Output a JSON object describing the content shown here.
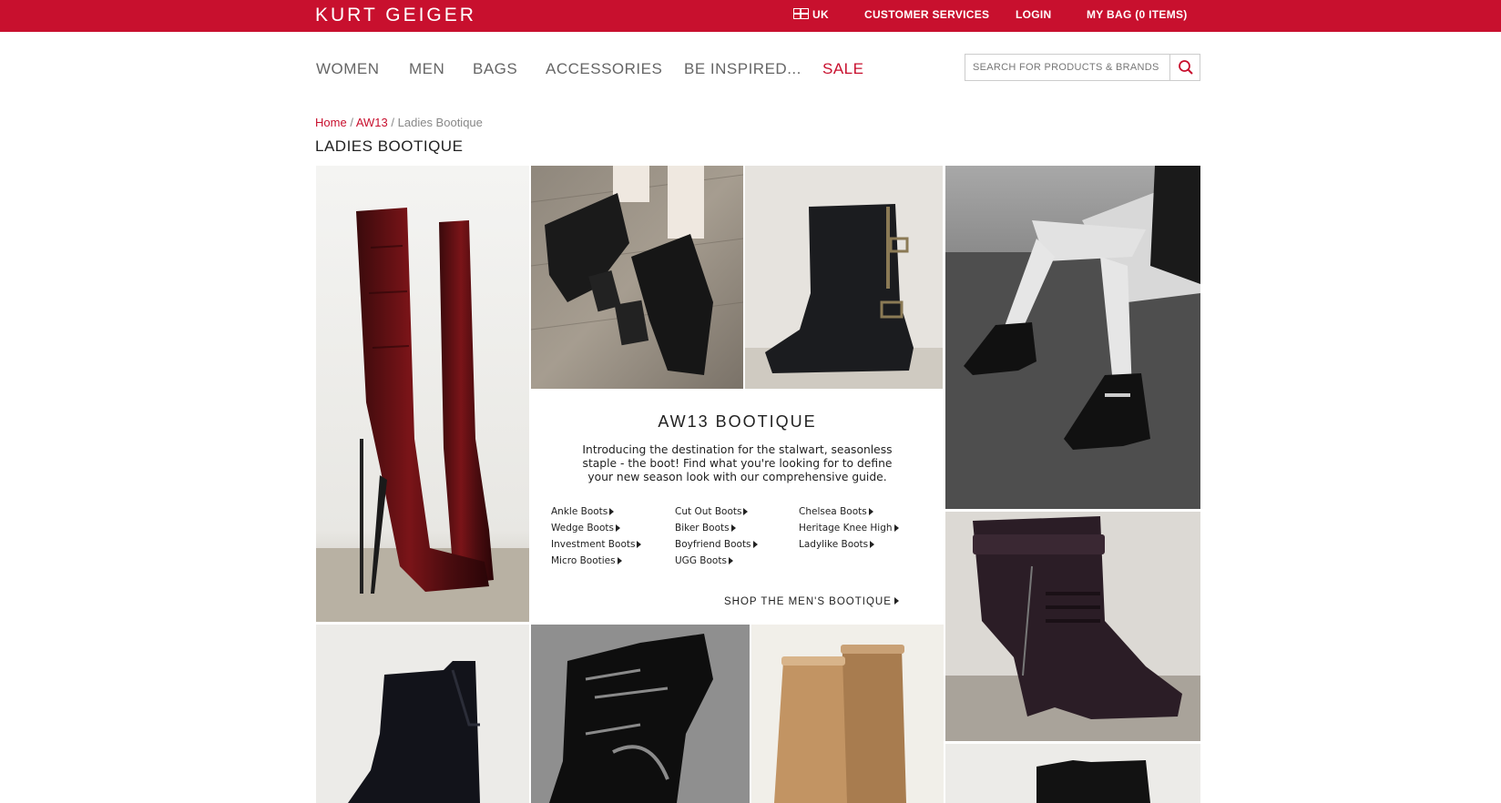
{
  "brand": {
    "logo_text": "KURT GEIGER",
    "accent": "#c8102e"
  },
  "topbar": {
    "country": "UK",
    "customer_services": "CUSTOMER SERVICES",
    "login": "LOGIN",
    "bag": "MY BAG (0 ITEMS)"
  },
  "nav": {
    "women": "WOMEN",
    "men": "MEN",
    "bags": "BAGS",
    "accessories": "ACCESSORIES",
    "inspired": "BE INSPIRED...",
    "sale": "SALE"
  },
  "search": {
    "placeholder": "SEARCH FOR PRODUCTS & BRANDS",
    "icon": "search-icon"
  },
  "breadcrumb": {
    "home": "Home",
    "aw13": "AW13",
    "current": "Ladies Bootique",
    "sep": "/"
  },
  "page_title": "LADIES BOOTIQUE",
  "bootique": {
    "title": "AW13 BOOTIQUE",
    "intro": "Introducing the destination for the stalwart, seasonless staple - the boot! Find what you're looking for to define your new season look with our comprehensive guide.",
    "links": [
      "Ankle Boots",
      "Cut Out Boots",
      "Chelsea Boots",
      "Wedge Boots",
      "Biker Boots",
      "Heritage Knee High",
      "Investment Boots",
      "Boyfriend Boots",
      "Ladylike Boots",
      "Micro Booties",
      "UGG Boots"
    ],
    "mens_link": "SHOP THE MEN'S BOOTIQUE"
  }
}
